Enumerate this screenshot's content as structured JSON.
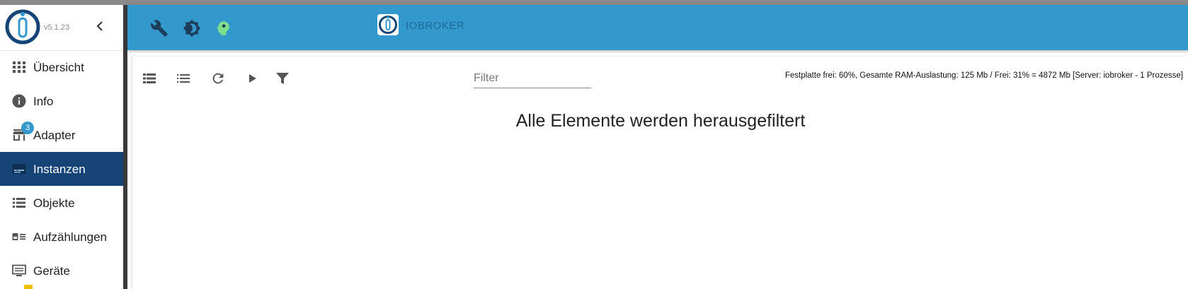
{
  "app": {
    "version": "v5.1.23",
    "brand": "IOBROKER"
  },
  "sidebar": {
    "items": [
      {
        "label": "Übersicht",
        "icon": "apps-grid-icon"
      },
      {
        "label": "Info",
        "icon": "info-icon"
      },
      {
        "label": "Adapter",
        "icon": "store-icon",
        "badge": "3"
      },
      {
        "label": "Instanzen",
        "icon": "instances-icon",
        "active": true
      },
      {
        "label": "Objekte",
        "icon": "list-icon"
      },
      {
        "label": "Aufzählungen",
        "icon": "enum-icon"
      },
      {
        "label": "Geräte",
        "icon": "devices-icon"
      }
    ]
  },
  "header": {
    "icons": [
      "wrench-icon",
      "brightness-icon",
      "expert-head-icon"
    ]
  },
  "toolbar": {
    "icons": [
      "view-table-icon",
      "view-list-icon",
      "refresh-icon",
      "play-icon",
      "filter-icon"
    ],
    "filter_placeholder": "Filter"
  },
  "status": {
    "text": "Festplatte frei: 60%, Gesamte RAM-Auslastung: 125 Mb / Frei: 31% = 4872 Mb [Server: iobroker - 1 Prozesse]"
  },
  "main": {
    "empty_message": "Alle Elemente werden herausgefiltert"
  },
  "colors": {
    "header": "#3399cc",
    "active_nav": "#164477",
    "badge": "#3399cc"
  }
}
